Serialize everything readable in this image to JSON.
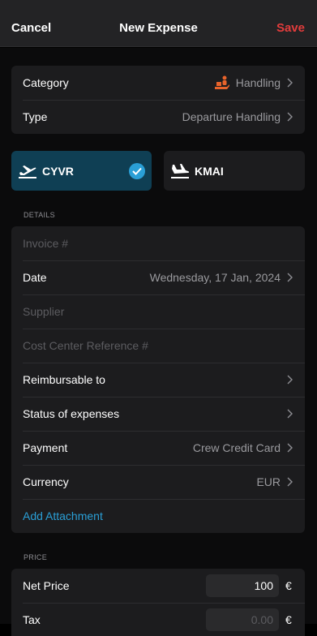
{
  "nav": {
    "cancel": "Cancel",
    "title": "New Expense",
    "save": "Save"
  },
  "category_card": {
    "category_label": "Category",
    "category_value": "Handling",
    "type_label": "Type",
    "type_value": "Departure Handling"
  },
  "airports": {
    "departure": "CYVR",
    "arrival": "KMAI"
  },
  "details": {
    "section_title": "DETAILS",
    "invoice_placeholder": "Invoice #",
    "date_label": "Date",
    "date_value": "Wednesday, 17 Jan, 2024",
    "supplier_placeholder": "Supplier",
    "cost_center_placeholder": "Cost Center Reference #",
    "reimbursable_label": "Reimbursable to",
    "status_label": "Status of expenses",
    "payment_label": "Payment",
    "payment_value": "Crew Credit Card",
    "currency_label": "Currency",
    "currency_value": "EUR",
    "add_attachment": "Add Attachment"
  },
  "price": {
    "section_title": "PRICE",
    "net_label": "Net Price",
    "net_value": "100",
    "tax_label": "Tax",
    "tax_placeholder": "0.00",
    "currency_symbol": "€"
  },
  "colors": {
    "accent": "#2a9fd6",
    "save": "#e23c3c",
    "departure_bg": "#0f3f54",
    "category_icon": "#e8632b"
  }
}
